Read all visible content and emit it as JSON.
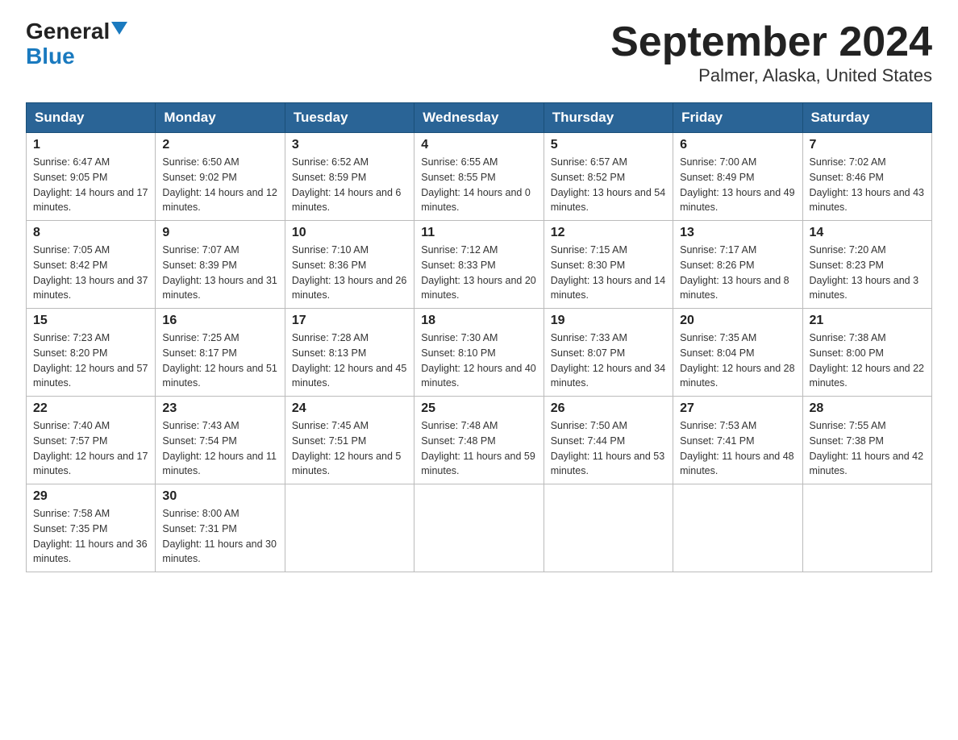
{
  "logo": {
    "text_general": "General",
    "text_blue": "Blue"
  },
  "title": "September 2024",
  "subtitle": "Palmer, Alaska, United States",
  "days_of_week": [
    "Sunday",
    "Monday",
    "Tuesday",
    "Wednesday",
    "Thursday",
    "Friday",
    "Saturday"
  ],
  "weeks": [
    [
      {
        "day": "1",
        "sunrise": "6:47 AM",
        "sunset": "9:05 PM",
        "daylight": "14 hours and 17 minutes."
      },
      {
        "day": "2",
        "sunrise": "6:50 AM",
        "sunset": "9:02 PM",
        "daylight": "14 hours and 12 minutes."
      },
      {
        "day": "3",
        "sunrise": "6:52 AM",
        "sunset": "8:59 PM",
        "daylight": "14 hours and 6 minutes."
      },
      {
        "day": "4",
        "sunrise": "6:55 AM",
        "sunset": "8:55 PM",
        "daylight": "14 hours and 0 minutes."
      },
      {
        "day": "5",
        "sunrise": "6:57 AM",
        "sunset": "8:52 PM",
        "daylight": "13 hours and 54 minutes."
      },
      {
        "day": "6",
        "sunrise": "7:00 AM",
        "sunset": "8:49 PM",
        "daylight": "13 hours and 49 minutes."
      },
      {
        "day": "7",
        "sunrise": "7:02 AM",
        "sunset": "8:46 PM",
        "daylight": "13 hours and 43 minutes."
      }
    ],
    [
      {
        "day": "8",
        "sunrise": "7:05 AM",
        "sunset": "8:42 PM",
        "daylight": "13 hours and 37 minutes."
      },
      {
        "day": "9",
        "sunrise": "7:07 AM",
        "sunset": "8:39 PM",
        "daylight": "13 hours and 31 minutes."
      },
      {
        "day": "10",
        "sunrise": "7:10 AM",
        "sunset": "8:36 PM",
        "daylight": "13 hours and 26 minutes."
      },
      {
        "day": "11",
        "sunrise": "7:12 AM",
        "sunset": "8:33 PM",
        "daylight": "13 hours and 20 minutes."
      },
      {
        "day": "12",
        "sunrise": "7:15 AM",
        "sunset": "8:30 PM",
        "daylight": "13 hours and 14 minutes."
      },
      {
        "day": "13",
        "sunrise": "7:17 AM",
        "sunset": "8:26 PM",
        "daylight": "13 hours and 8 minutes."
      },
      {
        "day": "14",
        "sunrise": "7:20 AM",
        "sunset": "8:23 PM",
        "daylight": "13 hours and 3 minutes."
      }
    ],
    [
      {
        "day": "15",
        "sunrise": "7:23 AM",
        "sunset": "8:20 PM",
        "daylight": "12 hours and 57 minutes."
      },
      {
        "day": "16",
        "sunrise": "7:25 AM",
        "sunset": "8:17 PM",
        "daylight": "12 hours and 51 minutes."
      },
      {
        "day": "17",
        "sunrise": "7:28 AM",
        "sunset": "8:13 PM",
        "daylight": "12 hours and 45 minutes."
      },
      {
        "day": "18",
        "sunrise": "7:30 AM",
        "sunset": "8:10 PM",
        "daylight": "12 hours and 40 minutes."
      },
      {
        "day": "19",
        "sunrise": "7:33 AM",
        "sunset": "8:07 PM",
        "daylight": "12 hours and 34 minutes."
      },
      {
        "day": "20",
        "sunrise": "7:35 AM",
        "sunset": "8:04 PM",
        "daylight": "12 hours and 28 minutes."
      },
      {
        "day": "21",
        "sunrise": "7:38 AM",
        "sunset": "8:00 PM",
        "daylight": "12 hours and 22 minutes."
      }
    ],
    [
      {
        "day": "22",
        "sunrise": "7:40 AM",
        "sunset": "7:57 PM",
        "daylight": "12 hours and 17 minutes."
      },
      {
        "day": "23",
        "sunrise": "7:43 AM",
        "sunset": "7:54 PM",
        "daylight": "12 hours and 11 minutes."
      },
      {
        "day": "24",
        "sunrise": "7:45 AM",
        "sunset": "7:51 PM",
        "daylight": "12 hours and 5 minutes."
      },
      {
        "day": "25",
        "sunrise": "7:48 AM",
        "sunset": "7:48 PM",
        "daylight": "11 hours and 59 minutes."
      },
      {
        "day": "26",
        "sunrise": "7:50 AM",
        "sunset": "7:44 PM",
        "daylight": "11 hours and 53 minutes."
      },
      {
        "day": "27",
        "sunrise": "7:53 AM",
        "sunset": "7:41 PM",
        "daylight": "11 hours and 48 minutes."
      },
      {
        "day": "28",
        "sunrise": "7:55 AM",
        "sunset": "7:38 PM",
        "daylight": "11 hours and 42 minutes."
      }
    ],
    [
      {
        "day": "29",
        "sunrise": "7:58 AM",
        "sunset": "7:35 PM",
        "daylight": "11 hours and 36 minutes."
      },
      {
        "day": "30",
        "sunrise": "8:00 AM",
        "sunset": "7:31 PM",
        "daylight": "11 hours and 30 minutes."
      },
      null,
      null,
      null,
      null,
      null
    ]
  ]
}
